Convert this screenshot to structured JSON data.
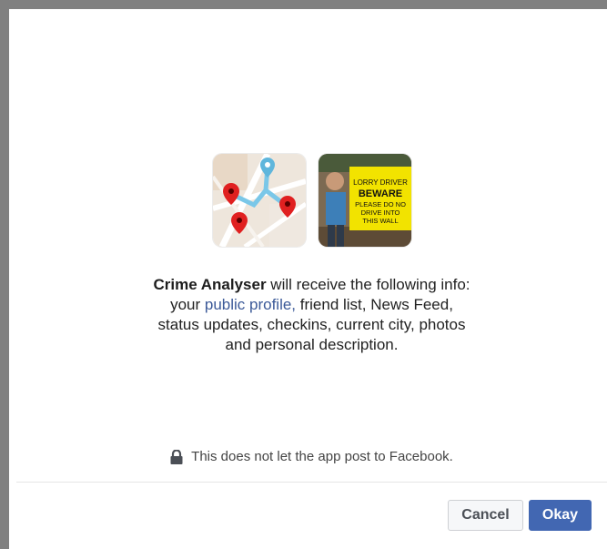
{
  "dialog": {
    "app_name": "Crime Analyser",
    "message_intro": " will receive the following info:",
    "message_line2_pre": "your ",
    "public_profile_link": "public profile,",
    "message_line2_post": " friend list, News Feed,",
    "message_line3": "status updates, checkins, current city, photos",
    "message_line4": "and personal description.",
    "notice_text": "This does not let the app post to Facebook.",
    "sign_lines": [
      "LORRY DRIVER",
      "BEWARE",
      "PLEASE DO NO",
      "DRIVE INTO",
      "THIS WALL"
    ]
  },
  "buttons": {
    "cancel_label": "Cancel",
    "okay_label": "Okay"
  },
  "icons": {
    "app_icon": "map-pins-icon",
    "user_photo": "user-photo-avatar",
    "lock": "lock-icon"
  },
  "colors": {
    "link": "#3b5998",
    "primary_button": "#4267b2",
    "frame": "#808080"
  }
}
